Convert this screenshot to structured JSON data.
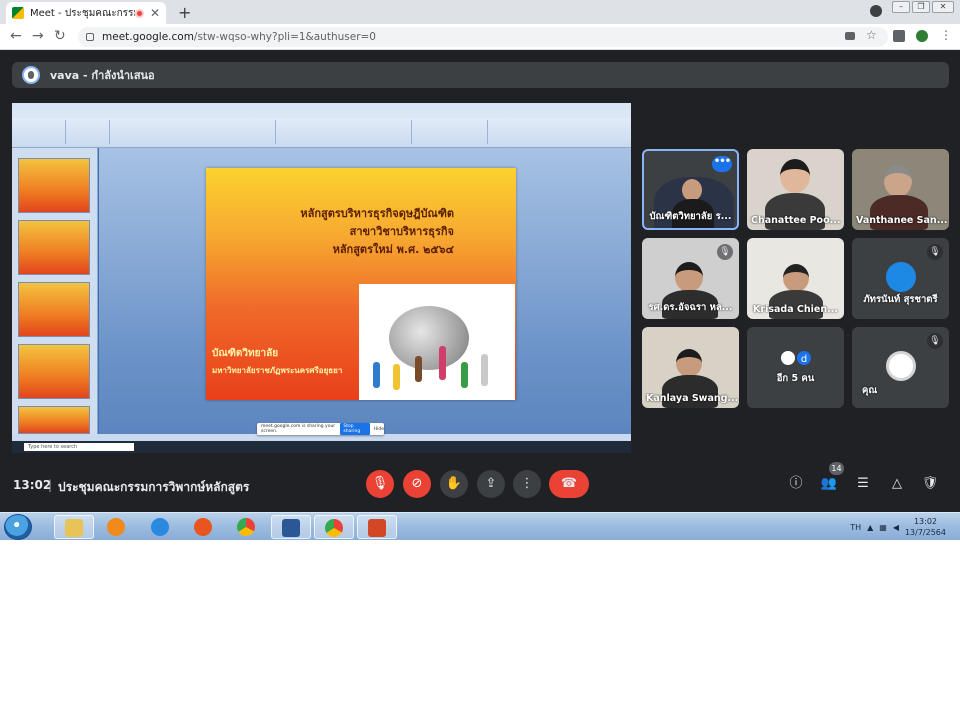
{
  "browser": {
    "tab_title": "Meet - ประชุมคณะกรรมการวิพากษ์",
    "tab_close": "✕",
    "new_tab": "+",
    "url_host": "meet.google.com",
    "url_path": "/stw-wqso-why?pli=1&authuser=0",
    "nav": {
      "back": "←",
      "forward": "→",
      "reload": "↻"
    },
    "window_buttons": {
      "minimize": "–",
      "restore": "❐",
      "close": "✕"
    }
  },
  "presenter": {
    "label": "vava - กำลังนำเสนอ"
  },
  "shared_screen": {
    "slide": {
      "title_lines": [
        "หลักสูตรบริหารธุรกิจดุษฎีบัณฑิต",
        "สาขาวิชาบริหารธุรกิจ",
        "หลักสูตรใหม่ พ.ศ. ๒๕๖๔"
      ],
      "sub_lines": [
        "บัณฑิตวิทยาลัย",
        "มหาวิทยาลัยราชภัฏพระนครศรีอยุธยา"
      ]
    },
    "taskbar_search": "Type here to search",
    "share_prompt": {
      "text": "meet.google.com is sharing your screen.",
      "stop": "Stop sharing",
      "hide": "Hide"
    }
  },
  "participants": [
    {
      "name": "บัณฑิตวิทยาลัย ร...",
      "menu": "•••",
      "active": true
    },
    {
      "name": "Chanattee Poo..."
    },
    {
      "name": "Vanthanee San..."
    },
    {
      "name": "รศ.ดร.อัจฉรา หล...",
      "muted": true
    },
    {
      "name": "Krisada Chien..."
    },
    {
      "name": "ภัทรนันท์ สุรชาตรี",
      "muted": true
    },
    {
      "name": "Kanlaya Swang..."
    },
    {
      "name": "อีก 5 คน",
      "others_letter": "d"
    },
    {
      "name": "คุณ",
      "muted": true
    }
  ],
  "mute_glyph": "🎙",
  "bottom_bar": {
    "time": "13:02",
    "separator": "|",
    "meeting_name": "ประชุมคณะกรรมการวิพากษ์หลักสูตร",
    "participant_count": "14",
    "controls": {
      "mic": "🎙",
      "camera": "⊘",
      "hand": "✋",
      "present": "⇪",
      "more": "⋮",
      "end": "☎"
    },
    "right": {
      "info": "ⓘ",
      "people": "👥",
      "chat": "☰",
      "activities": "△",
      "safety": "🛡"
    }
  },
  "windows_taskbar": {
    "language": "TH",
    "time": "13:02",
    "date": "13/7/2564"
  },
  "colors": {
    "meet_bg": "#202124",
    "tile_bg": "#3c4043",
    "danger": "#ea4335",
    "accent": "#8ab4f8"
  }
}
